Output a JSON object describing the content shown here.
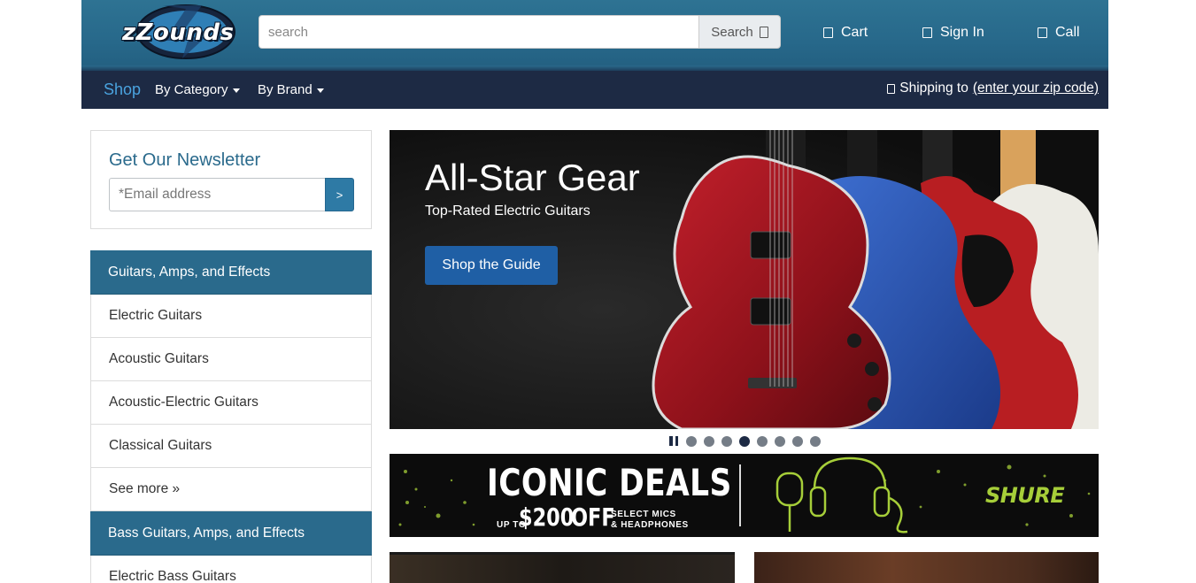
{
  "header": {
    "logo_text": "zZounds",
    "search": {
      "placeholder": "search",
      "value": "",
      "button_label": "Search"
    },
    "links": {
      "cart": "Cart",
      "sign_in": "Sign In",
      "call": "Call"
    }
  },
  "nav": {
    "shop": "Shop",
    "by_category": "By Category",
    "by_brand": "By Brand",
    "shipping_prefix": "Shipping to",
    "zip_link": "(enter your zip code)"
  },
  "newsletter": {
    "title": "Get Our Newsletter",
    "email_placeholder": "*Email address",
    "submit_label": ">"
  },
  "categories": [
    {
      "header": "Guitars, Amps, and Effects",
      "items": [
        "Electric Guitars",
        "Acoustic Guitars",
        "Acoustic-Electric Guitars",
        "Classical Guitars",
        "See more »"
      ]
    },
    {
      "header": "Bass Guitars, Amps, and Effects",
      "items": [
        "Electric Bass Guitars"
      ]
    }
  ],
  "hero": {
    "title": "All-Star Gear",
    "subtitle": "Top-Rated Electric Guitars",
    "cta": "Shop the Guide",
    "slide_count": 8,
    "active_slide": 3
  },
  "banner": {
    "title": "ICONIC DEALS",
    "up_to": "UP TO",
    "amount": "$200",
    "off": "OFF",
    "select_line1": "SELECT MICS",
    "select_line2": "& HEADPHONES",
    "brand": "SHURE"
  },
  "colors": {
    "header_blue": "#2a6a8c",
    "nav_navy": "#1d2a44",
    "link_blue": "#4aa3df",
    "cta_blue": "#1f5fa5",
    "brand_green": "#a6ce39"
  },
  "icons": [
    "search-icon",
    "cart-icon",
    "user-icon",
    "phone-icon",
    "location-icon",
    "pause-icon"
  ]
}
